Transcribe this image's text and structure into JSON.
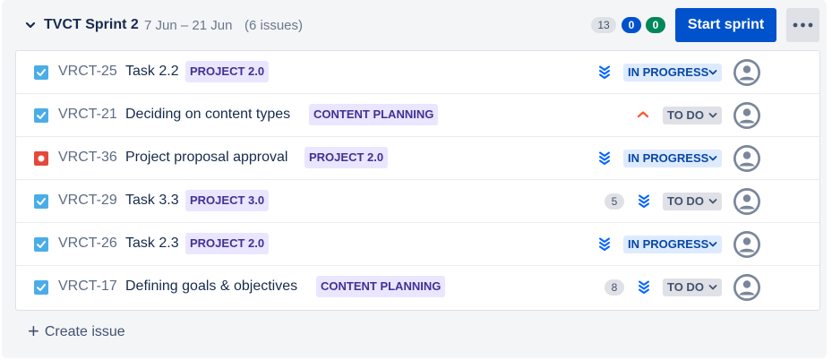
{
  "sprint": {
    "name": "TVCT Sprint 2",
    "dates": "7 Jun – 21 Jun",
    "issue_count": "(6 issues)",
    "counts": {
      "todo_points": "13",
      "in_progress_points": "0",
      "done_points": "0"
    },
    "start_button": "Start sprint",
    "more_icon": "more-horizontal-icon"
  },
  "colors": {
    "accent": "#0052cc",
    "done": "#00875a",
    "epic_bg": "#eae6ff",
    "epic_text": "#403294",
    "in_progress_bg": "#deebff",
    "todo_bg": "#dfe1e6",
    "bug_red": "#e5493a",
    "task_blue": "#4bade8"
  },
  "issues": [
    {
      "type": "task",
      "key": "VRCT-25",
      "summary": "Task 2.2",
      "epic": "PROJECT 2.0",
      "estimate": "",
      "priority": "lowest",
      "status": "IN PROGRESS"
    },
    {
      "type": "task",
      "key": "VRCT-21",
      "summary": "Deciding on content types",
      "epic": "CONTENT PLANNING",
      "estimate": "",
      "priority": "medium",
      "status": "TO DO"
    },
    {
      "type": "bug",
      "key": "VRCT-36",
      "summary": "Project proposal approval",
      "epic": "PROJECT 2.0",
      "estimate": "",
      "priority": "lowest",
      "status": "IN PROGRESS"
    },
    {
      "type": "task",
      "key": "VRCT-29",
      "summary": "Task 3.3",
      "epic": "PROJECT 3.0",
      "estimate": "5",
      "priority": "lowest",
      "status": "TO DO"
    },
    {
      "type": "task",
      "key": "VRCT-26",
      "summary": "Task 2.3",
      "epic": "PROJECT 2.0",
      "estimate": "",
      "priority": "lowest",
      "status": "IN PROGRESS"
    },
    {
      "type": "task",
      "key": "VRCT-17",
      "summary": "Defining goals & objectives",
      "epic": "CONTENT PLANNING",
      "estimate": "8",
      "priority": "lowest",
      "status": "TO DO"
    }
  ],
  "create_issue": {
    "label": "Create issue",
    "icon": "plus-icon"
  }
}
